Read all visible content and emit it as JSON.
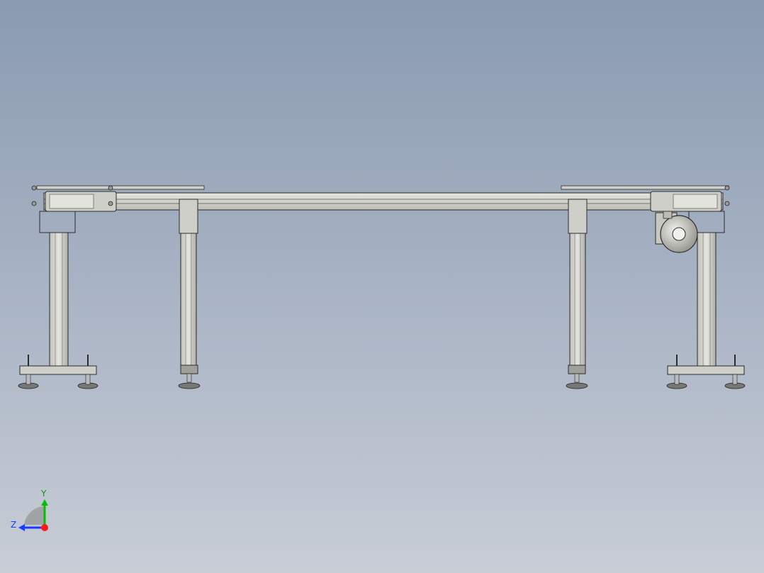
{
  "viewport": {
    "background_top": "#8a9bb0",
    "background_bottom": "#c8cdd6"
  },
  "model": {
    "line_color": "#2b2b2b",
    "metal_light": "#d9d9d4",
    "metal_mid": "#b8b8b2",
    "metal_dark": "#8e8e88",
    "accent_pink": "#e8c8c8"
  },
  "triad": {
    "y_label": "Y",
    "z_label": "Z",
    "y_color": "#00c000",
    "z_color": "#1a3cff",
    "x_color": "#ff1a1a"
  }
}
